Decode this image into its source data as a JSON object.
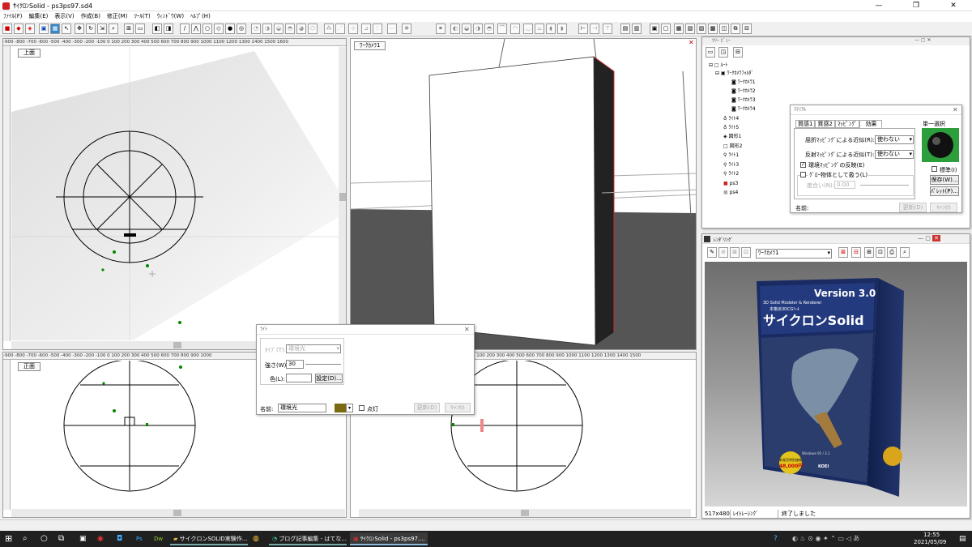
{
  "window": {
    "title": "ｻｲｸﾛﾝSolid - ps3ps97.sd4",
    "min": "—",
    "max": "❐",
    "close": "✕"
  },
  "menu": [
    "ﾌｧｲﾙ(F)",
    "編集(E)",
    "表示(V)",
    "作成(B)",
    "修正(M)",
    "ﾂｰﾙ(T)",
    "ｳｨﾝﾄﾞｳ(W)",
    "ﾍﾙﾌﾟ(H)"
  ],
  "views": {
    "top_left": {
      "label": "上面",
      "ruler": "-900 -800 -700 -600 -500 -400 -300 -200 -100  0  100 200 300 400 500 600 700 800 900 1000 1100 1200 1300 1400 1500 1600"
    },
    "camera": {
      "label": "ﾜｰｸｶﾒﾗ1"
    },
    "bottom_left": {
      "label": "正面",
      "ruler": "-900 -800 -700 -600 -500 -400 -300 -200 -100  0  100 200 300 400 500 600 700 800 900 1000"
    },
    "bottom_right": {
      "ruler": "0  100 200 300 400 500 600 700 800 900 1000 1100 1200 1300 1400 1500"
    }
  },
  "tree": {
    "title": "ﾂﾘｰ ﾋﾞｭｰ",
    "items": [
      "ﾙｰﾄ",
      "ﾜｰｸｶﾒﾗﾌｫﾙﾀﾞ",
      "ﾜｰｸｶﾒﾗ1",
      "ﾜｰｸｶﾒﾗ2",
      "ﾜｰｸｶﾒﾗ3",
      "ﾜｰｸｶﾒﾗ4",
      "ﾗｲﾄ4",
      "ﾗｲﾄ5",
      "図形1",
      "図形2",
      "ﾗｲﾄ1",
      "ﾗｲﾄ3",
      "ﾗｲﾄ2",
      "ps3",
      "ps4"
    ]
  },
  "material": {
    "title": "ﾏﾃﾘｱﾙ",
    "tabs": [
      "質感1",
      "質感2",
      "ﾏｯﾋﾟﾝｸﾞ",
      "効果"
    ],
    "row1_label": "屈折ﾏｯﾋﾟﾝｸﾞによる近似(R):",
    "row1_value": "使わない",
    "row2_label": "反射ﾏｯﾋﾟﾝｸﾞによる近似(T):",
    "row2_value": "使わない",
    "env_check": "環境ﾏｯﾋﾟﾝｸﾞの反映(E)",
    "glow_check": "ｸﾞﾛｰ物体として扱う(L)",
    "degree_label": "度合い(N):",
    "degree_value": "0.00",
    "name_label": "名前:",
    "single_select": "単一選択",
    "standard": "標準(I)",
    "save": "保存(W)...",
    "palette": "ﾊﾟﾚｯﾄ(P)...",
    "update": "更新(D)",
    "cancel": "ｷｬﾝｾﾙ"
  },
  "light": {
    "title": "ﾗｲﾄ",
    "type_label": "ﾀｲﾌﾟ(T):",
    "type_value": "環境光",
    "strength_label": "強さ(W):",
    "strength_value": "30",
    "color_label": "色(L):",
    "setting": "設定(D)...",
    "name_label": "名前:",
    "name_value": "環境光",
    "lit_check": "点灯",
    "update": "更新(D)",
    "cancel": "ｷｬﾝｾﾙ"
  },
  "render": {
    "title": "ﾚﾝﾀﾞﾘﾝｸﾞ",
    "camera": "ﾜｰｸｶﾒﾗ1",
    "status_size": "517x480",
    "status_mode": "ﾚｲﾄﾚｰｼﾝｸﾞ",
    "status_msg": "終了しました",
    "box_version": "Version 3.0",
    "box_subtitle": "3D Solid Modeler & Renderer",
    "box_jp": "本格派3DCGﾂｰﾙ",
    "box_name": "サイクロンSolid",
    "box_price_label": "新発売特別価格",
    "box_price": "48,000円",
    "box_os": "Windows 95 / 3.1",
    "box_brand": "KOEI"
  },
  "taskbar": {
    "items": [
      "サイクロンSOLID実験作...",
      "ブログ記事編集 - はてな...",
      "ｻｲｸﾛﾝSolid - ps3ps97...."
    ],
    "time": "12:55",
    "date": "2021/05/09"
  }
}
